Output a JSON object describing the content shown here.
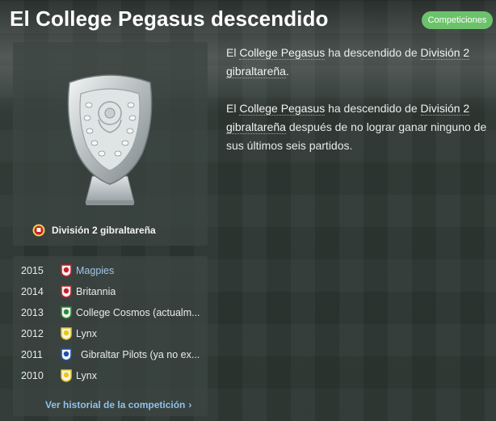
{
  "header": {
    "title": "El College Pegasus descendido",
    "badge": "Competiciones"
  },
  "trophy": {
    "competition": "División 2 gibraltareña"
  },
  "history": {
    "rows": [
      {
        "year": "2015",
        "club": "Magpies",
        "badge_color": "#c8202b"
      },
      {
        "year": "2014",
        "club": "Britannia",
        "badge_color": "#c8202b"
      },
      {
        "year": "2013",
        "club": "College Cosmos (actualm...",
        "badge_color": "#2a8a3a"
      },
      {
        "year": "2012",
        "club": "Lynx",
        "badge_color": "#e8c81a"
      },
      {
        "year": "2011",
        "club": "Gibraltar Pilots (ya no ex...",
        "badge_color": "#1f4fb0"
      },
      {
        "year": "2010",
        "club": "Lynx",
        "badge_color": "#e8c81a"
      }
    ],
    "link_label": "Ver historial de la competición"
  },
  "news": {
    "p1": {
      "pre": "El ",
      "club": "College Pegasus",
      "mid": " ha descendido de ",
      "league": "División 2 gibraltareña",
      "post": "."
    },
    "p2": {
      "pre": "El ",
      "club": "College Pegasus",
      "mid": " ha descendido de ",
      "league": "División 2 gibraltareña",
      "post": " después de no lograr ganar ninguno de sus últimos seis partidos."
    }
  },
  "colors": {
    "accent_green": "#6cc26a",
    "link_blue": "#8fc1ea"
  }
}
